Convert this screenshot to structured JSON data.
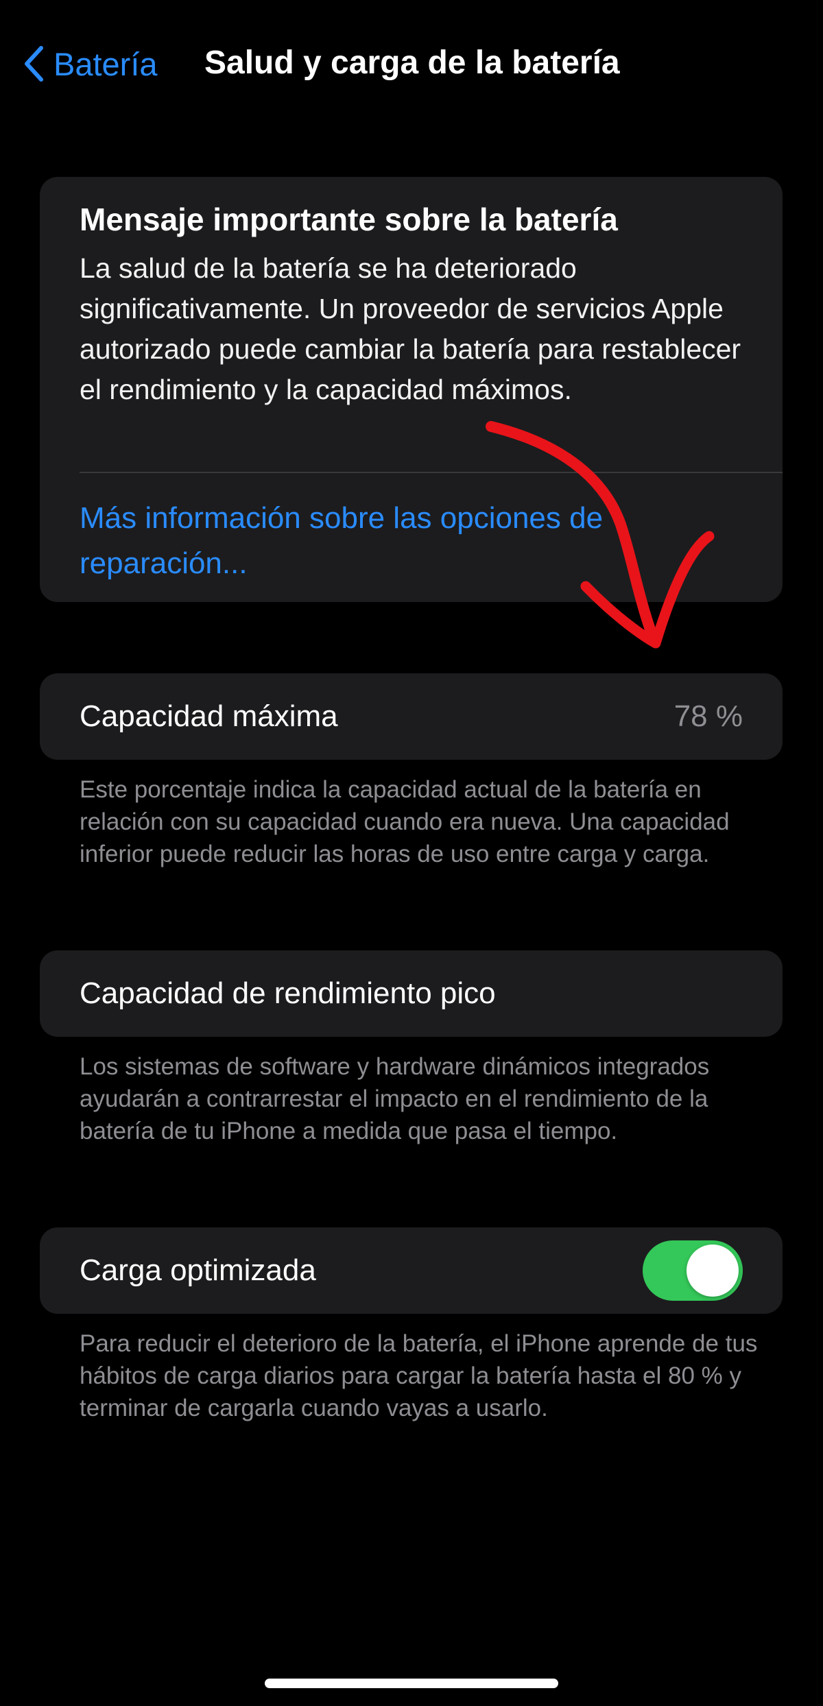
{
  "nav": {
    "back_label": "Batería",
    "title": "Salud y carga de la batería"
  },
  "message_card": {
    "title": "Mensaje importante sobre la batería",
    "body": "La salud de la batería se ha deteriorado significativamente. Un proveedor de servicios Apple autorizado puede cambiar la batería para restablecer el rendimiento y la capacidad máximos.",
    "link": "Más información sobre las opciones de reparación..."
  },
  "max_capacity": {
    "label": "Capacidad máxima",
    "value": "78 %",
    "footnote": "Este porcentaje indica la capacidad actual de la batería en relación con su capacidad cuando era nueva. Una capacidad inferior puede reducir las horas de uso entre carga y carga."
  },
  "peak_performance": {
    "label": "Capacidad de rendimiento pico",
    "footnote": "Los sistemas de software y hardware dinámicos integrados ayudarán a contrarrestar el impacto en el rendimiento de la batería de tu iPhone a medida que pasa el tiempo."
  },
  "optimized_charging": {
    "label": "Carga optimizada",
    "enabled": true,
    "footnote": "Para reducir el deterioro de la batería, el iPhone aprende de tus hábitos de carga diarios para cargar la batería hasta el 80 % y terminar de cargarla cuando vayas a usarlo."
  },
  "colors": {
    "accent": "#2a8cff",
    "toggle_on": "#34c759",
    "annotation_arrow": "#e8141a"
  },
  "icons": {
    "back": "chevron-left-icon"
  }
}
